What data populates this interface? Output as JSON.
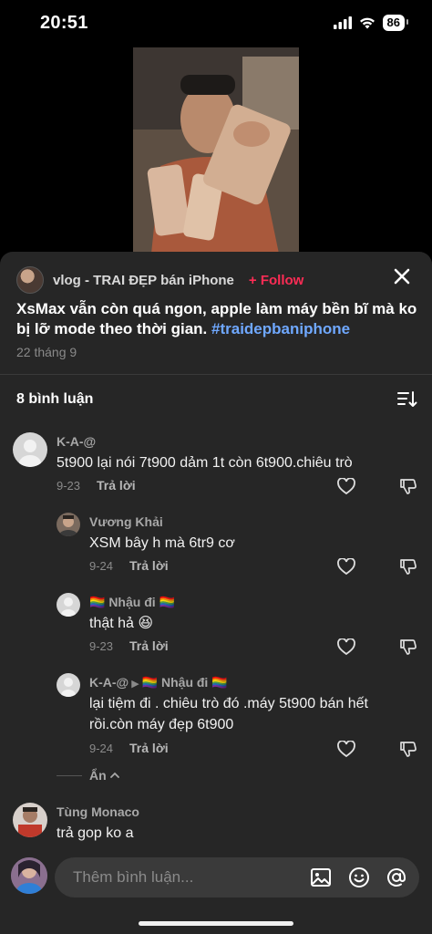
{
  "status_bar": {
    "time": "20:51",
    "battery": "86",
    "icons": [
      "signal-icon",
      "wifi-icon",
      "battery-icon"
    ]
  },
  "post": {
    "author": "vlog - TRAI ĐẸP bán iPhone",
    "follow_label": "+ Follow",
    "caption_text": "XsMax vẫn còn quá ngon, apple làm máy bền bĩ mà ko bị lỡ mode theo thời gian. ",
    "hashtag": "#traidepbaniphone",
    "date": "22 tháng 9"
  },
  "comments_header": {
    "count_label": "8 bình luận"
  },
  "comments": [
    {
      "user": "K-A-@",
      "text": "5t900 lại nói 7t900 dảm 1t còn 6t900.chiêu trò",
      "date": "9-23",
      "reply_label": "Trả lời"
    },
    {
      "user": "Vương Khải",
      "text": "XSM bây h mà 6tr9 cơ",
      "date": "9-24",
      "reply_label": "Trả lời"
    },
    {
      "user": "🏳️‍🌈 Nhậu đi 🏳️‍🌈",
      "text": "thật hả 😆",
      "date": "9-23",
      "reply_label": "Trả lời"
    },
    {
      "user": "K-A-@",
      "reply_to": "🏳️‍🌈 Nhậu đi 🏳️‍🌈",
      "text": "lại tiệm đi . chiêu trò đó .máy 5t900 bán hết rồi.còn máy đẹp 6t900",
      "date": "9-24",
      "reply_label": "Trả lời"
    },
    {
      "user": "Tùng Monaco",
      "text": "trả gop ko a"
    }
  ],
  "hide_label": "Ẩn",
  "input": {
    "placeholder": "Thêm bình luận..."
  },
  "colors": {
    "accent": "#fe2c55",
    "hashtag": "#6fa8ff",
    "sheet": "#262626"
  }
}
